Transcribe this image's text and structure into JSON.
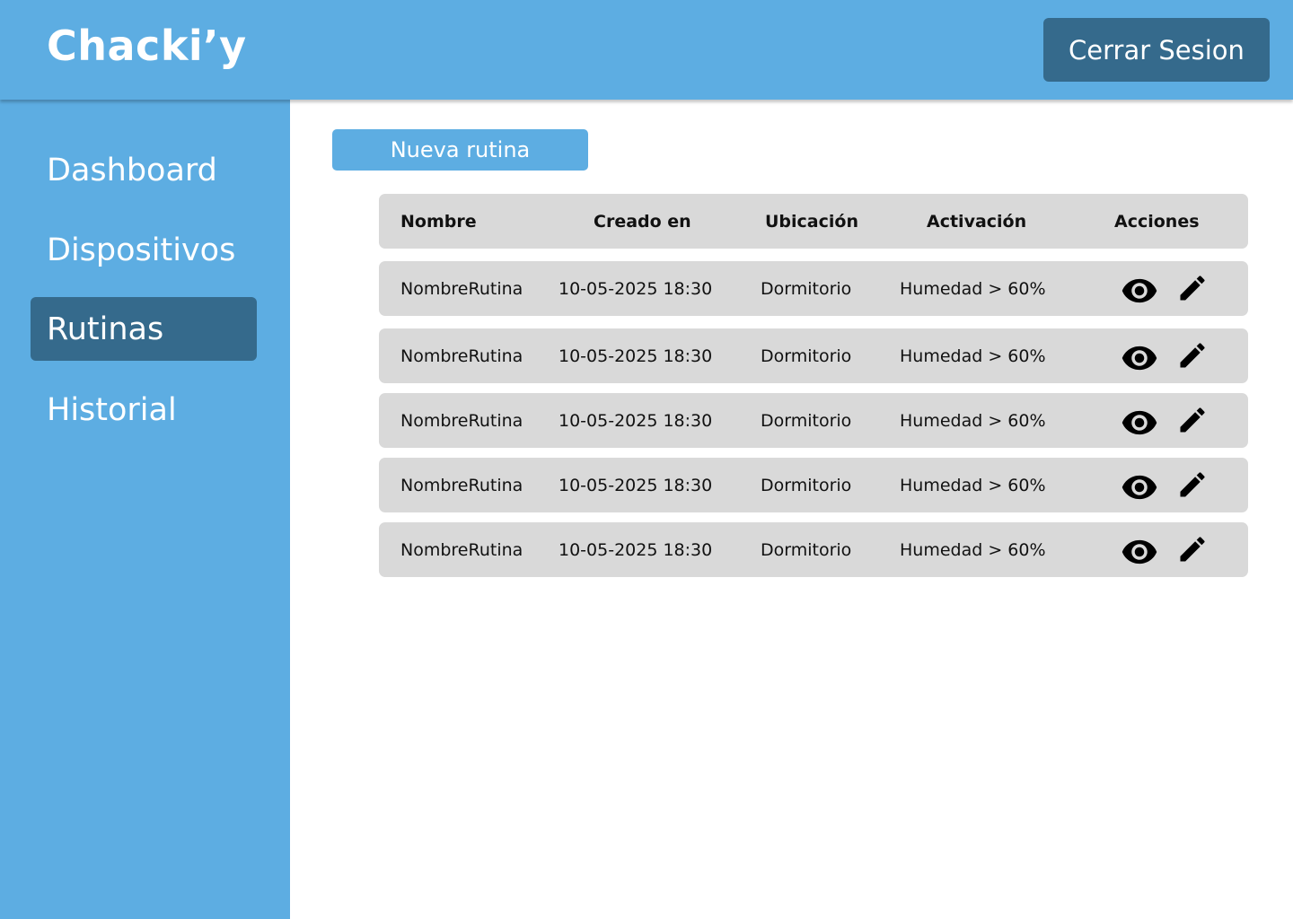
{
  "app": {
    "logo": "Chacki’y",
    "logout_label": "Cerrar Sesion"
  },
  "sidebar": {
    "items": [
      {
        "label": "Dashboard",
        "active": false
      },
      {
        "label": "Dispositivos",
        "active": false
      },
      {
        "label": "Rutinas",
        "active": true
      },
      {
        "label": "Historial",
        "active": false
      }
    ]
  },
  "main": {
    "new_button_label": "Nueva rutina",
    "table": {
      "headers": [
        "Nombre",
        "Creado en",
        "Ubicación",
        "Activación",
        "Acciones"
      ],
      "rows": [
        {
          "name": "NombreRutina",
          "created": "10-05-2025  18:30",
          "location": "Dormitorio",
          "activation": "Humedad > 60%"
        },
        {
          "name": "NombreRutina",
          "created": "10-05-2025  18:30",
          "location": "Dormitorio",
          "activation": "Humedad > 60%"
        },
        {
          "name": "NombreRutina",
          "created": "10-05-2025  18:30",
          "location": "Dormitorio",
          "activation": "Humedad > 60%"
        },
        {
          "name": "NombreRutina",
          "created": "10-05-2025  18:30",
          "location": "Dormitorio",
          "activation": "Humedad > 60%"
        },
        {
          "name": "NombreRutina",
          "created": "10-05-2025  18:30",
          "location": "Dormitorio",
          "activation": "Humedad > 60%"
        }
      ],
      "row_icons": [
        "eye-icon",
        "pencil-icon"
      ]
    }
  },
  "colors": {
    "primary": "#5DADE2",
    "primary_dark": "#356A8C",
    "row_bg": "#D9D9D9",
    "text": "#111111",
    "white": "#FFFFFF"
  }
}
